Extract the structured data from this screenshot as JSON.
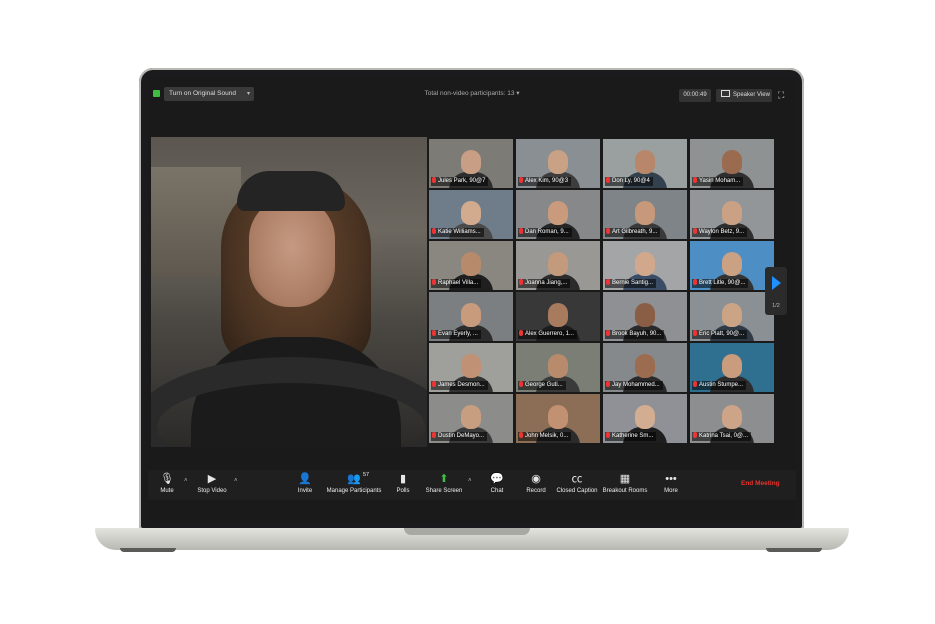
{
  "topbar": {
    "original_sound_label": "Turn on Original Sound",
    "non_video_label": "Total non-video participants: 13",
    "timer": "00:00:49",
    "view_label": "Speaker View"
  },
  "participants": [
    {
      "name": "Jules Park, 90@7",
      "bg": "#7d7b76",
      "skin": "#c89f85",
      "shirt": "#2d2d2d"
    },
    {
      "name": "Alex Kim, 90@3",
      "bg": "#8a8f94",
      "skin": "#c9a184",
      "shirt": "#3d3d3d"
    },
    {
      "name": "Don Ly, 90@4",
      "bg": "#9aa09f",
      "skin": "#b8876a",
      "shirt": "#33404d",
      "active": true
    },
    {
      "name": "Yasin Moham...",
      "bg": "#8f9293",
      "skin": "#9a6b4f",
      "shirt": "#2f2f2f"
    },
    {
      "name": "Katie Williams...",
      "bg": "#6f7d8a",
      "skin": "#d2ab8f",
      "shirt": "#4a4a4a"
    },
    {
      "name": "Dan Roman, 9...",
      "bg": "#86888a",
      "skin": "#c99a7c",
      "shirt": "#262626"
    },
    {
      "name": "Art Gilbreath, 9...",
      "bg": "#7e8488",
      "skin": "#c7987a",
      "shirt": "#3a3a3a"
    },
    {
      "name": "Waylon Betz, 9...",
      "bg": "#939699",
      "skin": "#caa184",
      "shirt": "#2e2e2e"
    },
    {
      "name": "Raphael Villa...",
      "bg": "#8a8780",
      "skin": "#b88a6c",
      "shirt": "#1f1f1f"
    },
    {
      "name": "Joanna Jiang,...",
      "bg": "#9a9894",
      "skin": "#c49a7c",
      "shirt": "#2b2b2b"
    },
    {
      "name": "Bernie Santig...",
      "bg": "#a3a5a6",
      "skin": "#d1a88c",
      "shirt": "#3b4d66"
    },
    {
      "name": "Brett Litle, 90@...",
      "bg": "#4d8fc4",
      "skin": "#caa183",
      "shirt": "#333333"
    },
    {
      "name": "Evan Eyerly, ...",
      "bg": "#7c7f82",
      "skin": "#c99b7d",
      "shirt": "#2c2c2c"
    },
    {
      "name": "Alex Guerrero, 1...",
      "bg": "#383838",
      "skin": "#a87a5e",
      "shirt": "#1c1c1c"
    },
    {
      "name": "Brook Bayuh, 90...",
      "bg": "#8e9093",
      "skin": "#8a5e45",
      "shirt": "#2a2a2a"
    },
    {
      "name": "Eric Platt, 90@...",
      "bg": "#8a9094",
      "skin": "#cba486",
      "shirt": "#2f3a46"
    },
    {
      "name": "James Desmon...",
      "bg": "#9fa09c",
      "skin": "#c09174",
      "shirt": "#333333"
    },
    {
      "name": "George Guti...",
      "bg": "#7a7e74",
      "skin": "#b98b6d",
      "shirt": "#3a3a3a"
    },
    {
      "name": "Jay Mohammed...",
      "bg": "#86898b",
      "skin": "#9b6c50",
      "shirt": "#2a2a2a"
    },
    {
      "name": "Austin Stumpe...",
      "bg": "#2f6f8f",
      "skin": "#c99c7e",
      "shirt": "#2c2c2c"
    },
    {
      "name": "Dustin DeMayo...",
      "bg": "#8c8d8b",
      "skin": "#c89e80",
      "shirt": "#3a3a3a"
    },
    {
      "name": "John Melsik, 0...",
      "bg": "#8b6e55",
      "skin": "#c29172",
      "shirt": "#2b2b2b"
    },
    {
      "name": "Katherine Sm...",
      "bg": "#8f9196",
      "skin": "#d3ad92",
      "shirt": "#1e1e1e"
    },
    {
      "name": "Katrina Tsai, 0@...",
      "bg": "#8c8e90",
      "skin": "#cda488",
      "shirt": "#2a2a2a"
    }
  ],
  "pagination": "1/2",
  "toolbar": {
    "mute": "Mute",
    "stop_video": "Stop Video",
    "invite": "Invite",
    "participants_count": "57",
    "manage_participants": "Manage Participants",
    "polls": "Polls",
    "share_screen": "Share Screen",
    "chat": "Chat",
    "record": "Record",
    "closed_caption": "Closed Caption",
    "breakout_rooms": "Breakout Rooms",
    "more": "More",
    "end_meeting": "End Meeting",
    "share_color": "#3fbf3f",
    "end_color": "#e8332c"
  }
}
